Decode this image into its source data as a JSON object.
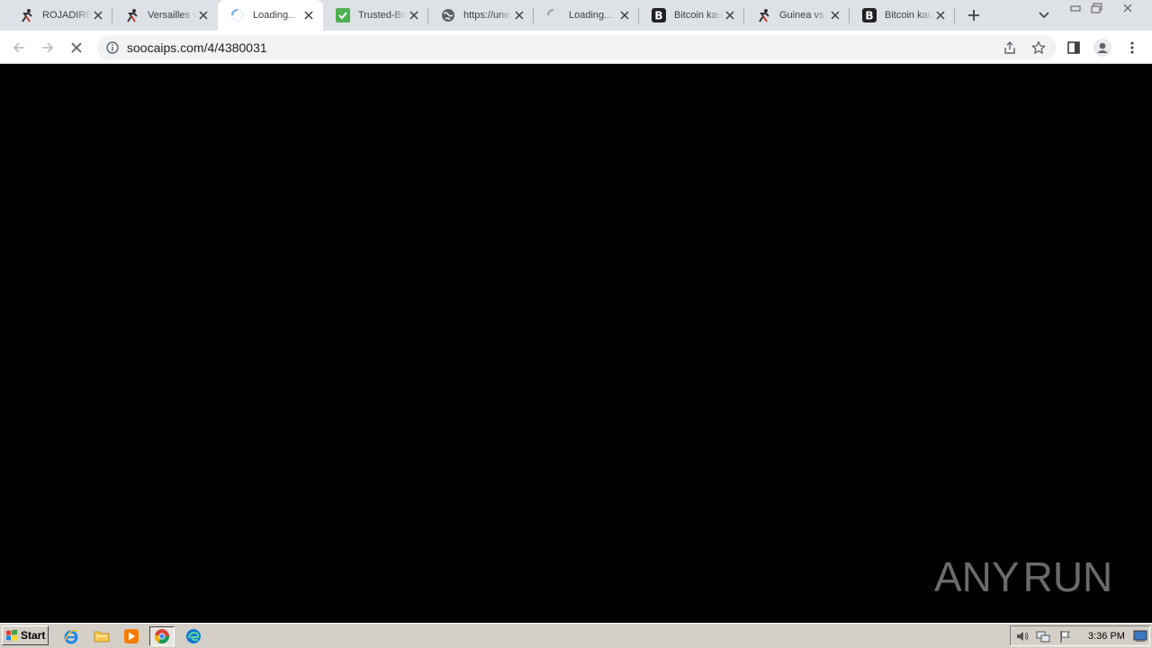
{
  "browser": {
    "tabs": [
      {
        "title": "ROJADIRECTA",
        "favicon": "soccer-player-icon",
        "active": false
      },
      {
        "title": "Versailles vs",
        "favicon": "soccer-player-icon",
        "active": false
      },
      {
        "title": "Loading...",
        "favicon": "loading-spinner-icon",
        "active": true
      },
      {
        "title": "Trusted-Broker",
        "favicon": "green-shield-icon",
        "active": false
      },
      {
        "title": "https://unex",
        "favicon": "globe-icon",
        "active": false
      },
      {
        "title": "Loading...",
        "favicon": "loading-spinner-icon",
        "active": false
      },
      {
        "title": "Bitcoin kaufen",
        "favicon": "bitcoin-b-icon",
        "active": false
      },
      {
        "title": "Guinea vs M",
        "favicon": "soccer-player-icon",
        "active": false
      },
      {
        "title": "Bitcoin kaufen",
        "favicon": "bitcoin-b-icon",
        "active": false
      }
    ],
    "address": {
      "url": "soocaips.com/4/4380031"
    }
  },
  "watermark": {
    "left": "ANY",
    "right": "RUN"
  },
  "taskbar": {
    "start_label": "Start",
    "clock": "3:36 PM"
  },
  "colors": {
    "tabstrip": "#dee1e6",
    "toolbar": "#ffffff",
    "omnibox": "#f1f3f4",
    "content": "#000000",
    "taskbar": "#d4d0c8",
    "watermark": "#6b6b6b"
  }
}
